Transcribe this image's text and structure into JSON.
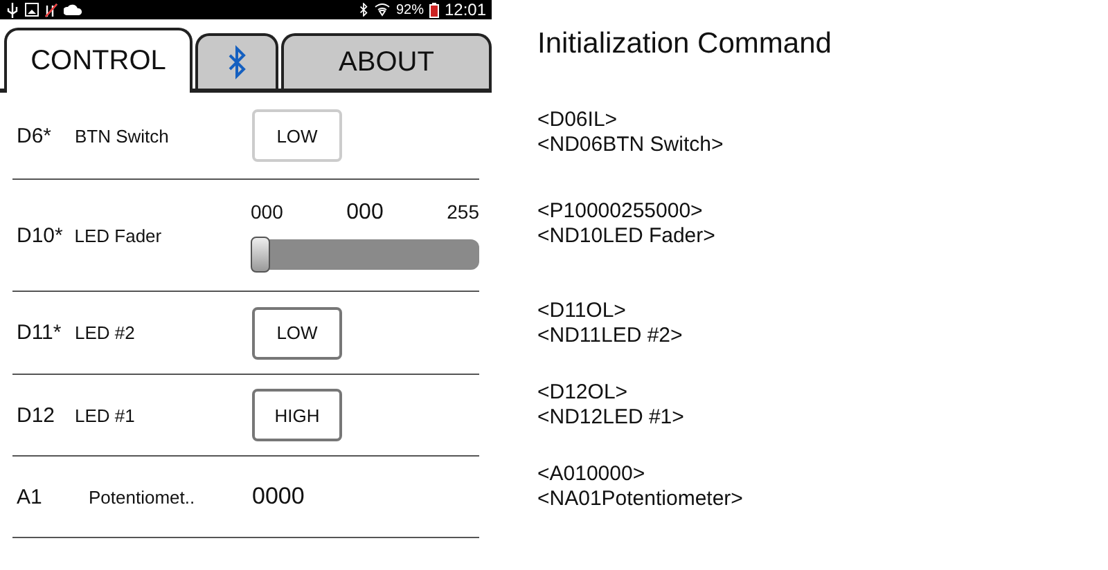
{
  "status_bar": {
    "battery": "92%",
    "time": "12:01"
  },
  "tabs": [
    {
      "kind": "text",
      "label": "CONTROL",
      "selected": true
    },
    {
      "kind": "bluetooth",
      "selected": false
    },
    {
      "kind": "text",
      "label": "ABOUT",
      "selected": false
    }
  ],
  "rows": [
    {
      "kind": "button",
      "pin": "D6*",
      "name": "BTN Switch",
      "button": "LOW",
      "disabled": true
    },
    {
      "kind": "slider",
      "pin": "D10*",
      "name": "LED Fader",
      "min": "000",
      "value": "000",
      "max": "255",
      "level": 0
    },
    {
      "kind": "button",
      "pin": "D11*",
      "name": "LED #2",
      "button": "LOW",
      "disabled": false
    },
    {
      "kind": "button",
      "pin": "D12",
      "name": "LED #1",
      "button": "HIGH",
      "disabled": false
    },
    {
      "kind": "reading",
      "pin": "A1",
      "name": "Potentiomet..",
      "reading": "0000"
    }
  ],
  "commands": {
    "title": "Initialization Command",
    "groups": [
      {
        "lines": [
          "<D06IL>",
          "<ND06BTN Switch>"
        ]
      },
      {
        "lines": [
          "<P10000255000>",
          "<ND10LED Fader>"
        ]
      },
      {
        "lines": [
          "<D11OL>",
          "<ND11LED #2>"
        ]
      },
      {
        "lines": [
          "<D12OL>",
          "<ND12LED #1>"
        ]
      },
      {
        "lines": [
          "<A010000>",
          "<NA01Potentiometer>"
        ]
      }
    ]
  }
}
